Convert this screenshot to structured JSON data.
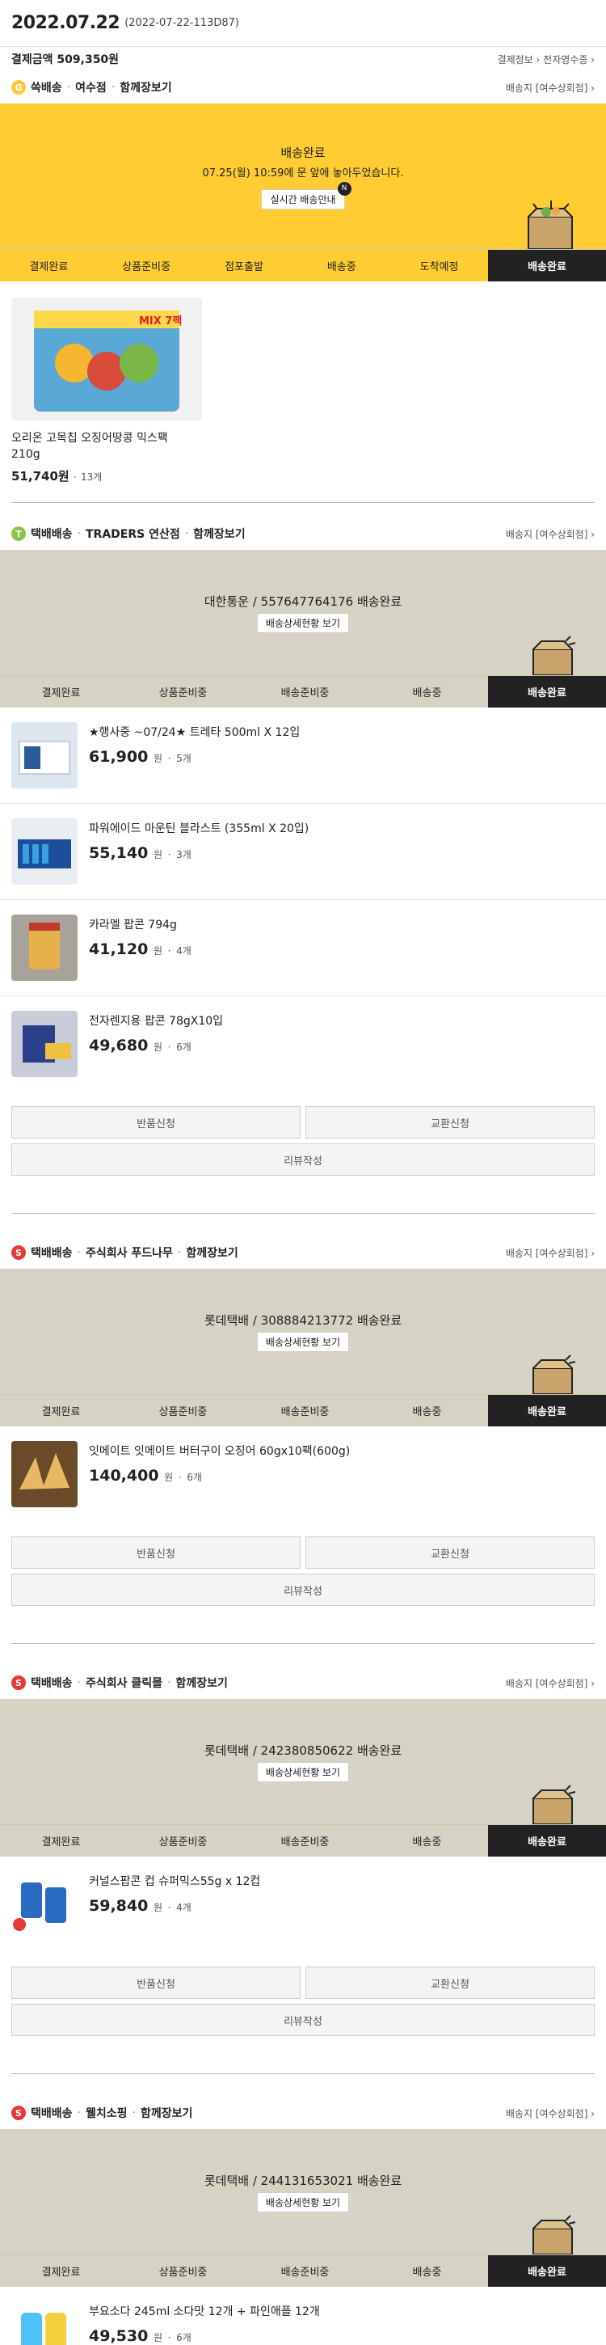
{
  "header": {
    "date": "2022.07.22",
    "order_no": "(2022-07-22-113D87)"
  },
  "payment": {
    "label": "결제금액",
    "amount": "509,350원",
    "link1": "결제정보 ›",
    "link2": "전자영수증 ›"
  },
  "groups": [
    {
      "badge": "G",
      "type": "쓱배송",
      "sep1": "·",
      "store": "여수점",
      "sep2": "·",
      "more": "함께장보기",
      "addr": "배송지 [여수상회점] ›",
      "status_title": "배송완료",
      "status_sub": "07.25(월) 10:59에 문 앞에 놓아두었습니다.",
      "status_button": "실시간 배송안내",
      "badge_new": "N",
      "steps": [
        "결제완료",
        "상품준비중",
        "점포출발",
        "배송중",
        "도착예정",
        "배송완료"
      ],
      "product": {
        "name": "오리온 고목칩 오징어땅콩 믹스팩",
        "spec": "210g",
        "price": "51,740원",
        "sep": "·",
        "qty": "13개",
        "pkg": "MIX 7팩"
      }
    },
    {
      "badge": "T",
      "type": "택배배송",
      "sep1": "·",
      "store": "TRADERS 연산점",
      "sep2": "·",
      "more": "함께장보기",
      "addr": "배송지 [여수상회점] ›",
      "status_title": "대한통운 / 557647764176 배송완료",
      "status_button": "배송상세현황 보기",
      "steps": [
        "결제완료",
        "상품준비중",
        "배송준비중",
        "배송중",
        "배송완료"
      ],
      "items": [
        {
          "name": "★행사중 ~07/24★ 트레타 500ml X 12입",
          "price": "61,900",
          "unit": "원",
          "sep": "·",
          "qty": "5개"
        },
        {
          "name": "파워에이드 마운틴 블라스트 (355ml X 20입)",
          "price": "55,140",
          "unit": "원",
          "sep": "·",
          "qty": "3개"
        },
        {
          "name": "카라멜 팝콘 794g",
          "price": "41,120",
          "unit": "원",
          "sep": "·",
          "qty": "4개"
        },
        {
          "name": "전자렌지용 팝콘 78gX10입",
          "price": "49,680",
          "unit": "원",
          "sep": "·",
          "qty": "6개"
        }
      ],
      "return": "반품신청",
      "exchange": "교환신청",
      "review": "리뷰작성"
    },
    {
      "badge": "S",
      "type": "택배배송",
      "sep1": "·",
      "store": "주식회사 푸드나무",
      "sep2": "·",
      "more": "함께장보기",
      "addr": "배송지 [여수상회점] ›",
      "status_title": "롯데택배 / 308884213772 배송완료",
      "status_button": "배송상세현황 보기",
      "steps": [
        "결제완료",
        "상품준비중",
        "배송준비중",
        "배송중",
        "배송완료"
      ],
      "items": [
        {
          "name": "잇메이트 잇메이트 버터구이 오징어 60gx10팩(600g)",
          "price": "140,400",
          "unit": "원",
          "sep": "·",
          "qty": "6개"
        }
      ],
      "return": "반품신청",
      "exchange": "교환신청",
      "review": "리뷰작성"
    },
    {
      "badge": "S",
      "type": "택배배송",
      "sep1": "·",
      "store": "주식회사 클릭몰",
      "sep2": "·",
      "more": "함께장보기",
      "addr": "배송지 [여수상회점] ›",
      "status_title": "롯데택배 / 242380850622 배송완료",
      "status_button": "배송상세현황 보기",
      "steps": [
        "결제완료",
        "상품준비중",
        "배송준비중",
        "배송중",
        "배송완료"
      ],
      "items": [
        {
          "name": "커널스팝콘 컵 슈퍼믹스55g x 12컵",
          "price": "59,840",
          "unit": "원",
          "sep": "·",
          "qty": "4개"
        }
      ],
      "return": "반품신청",
      "exchange": "교환신청",
      "review": "리뷰작성"
    },
    {
      "badge": "S",
      "type": "택배배송",
      "sep1": "·",
      "store": "웰치소핑",
      "sep2": "·",
      "more": "함께장보기",
      "addr": "배송지 [여수상회점] ›",
      "status_title": "롯데택배 / 244131653021 배송완료",
      "status_button": "배송상세현황 보기",
      "steps": [
        "결제완료",
        "상품준비중",
        "배송준비중",
        "배송중",
        "배송완료"
      ],
      "items": [
        {
          "name": "부요소다 245ml 소다맛 12개 + 파인애플 12개",
          "price": "49,530",
          "unit": "원",
          "sep": "·",
          "qty": "6개"
        }
      ]
    }
  ]
}
